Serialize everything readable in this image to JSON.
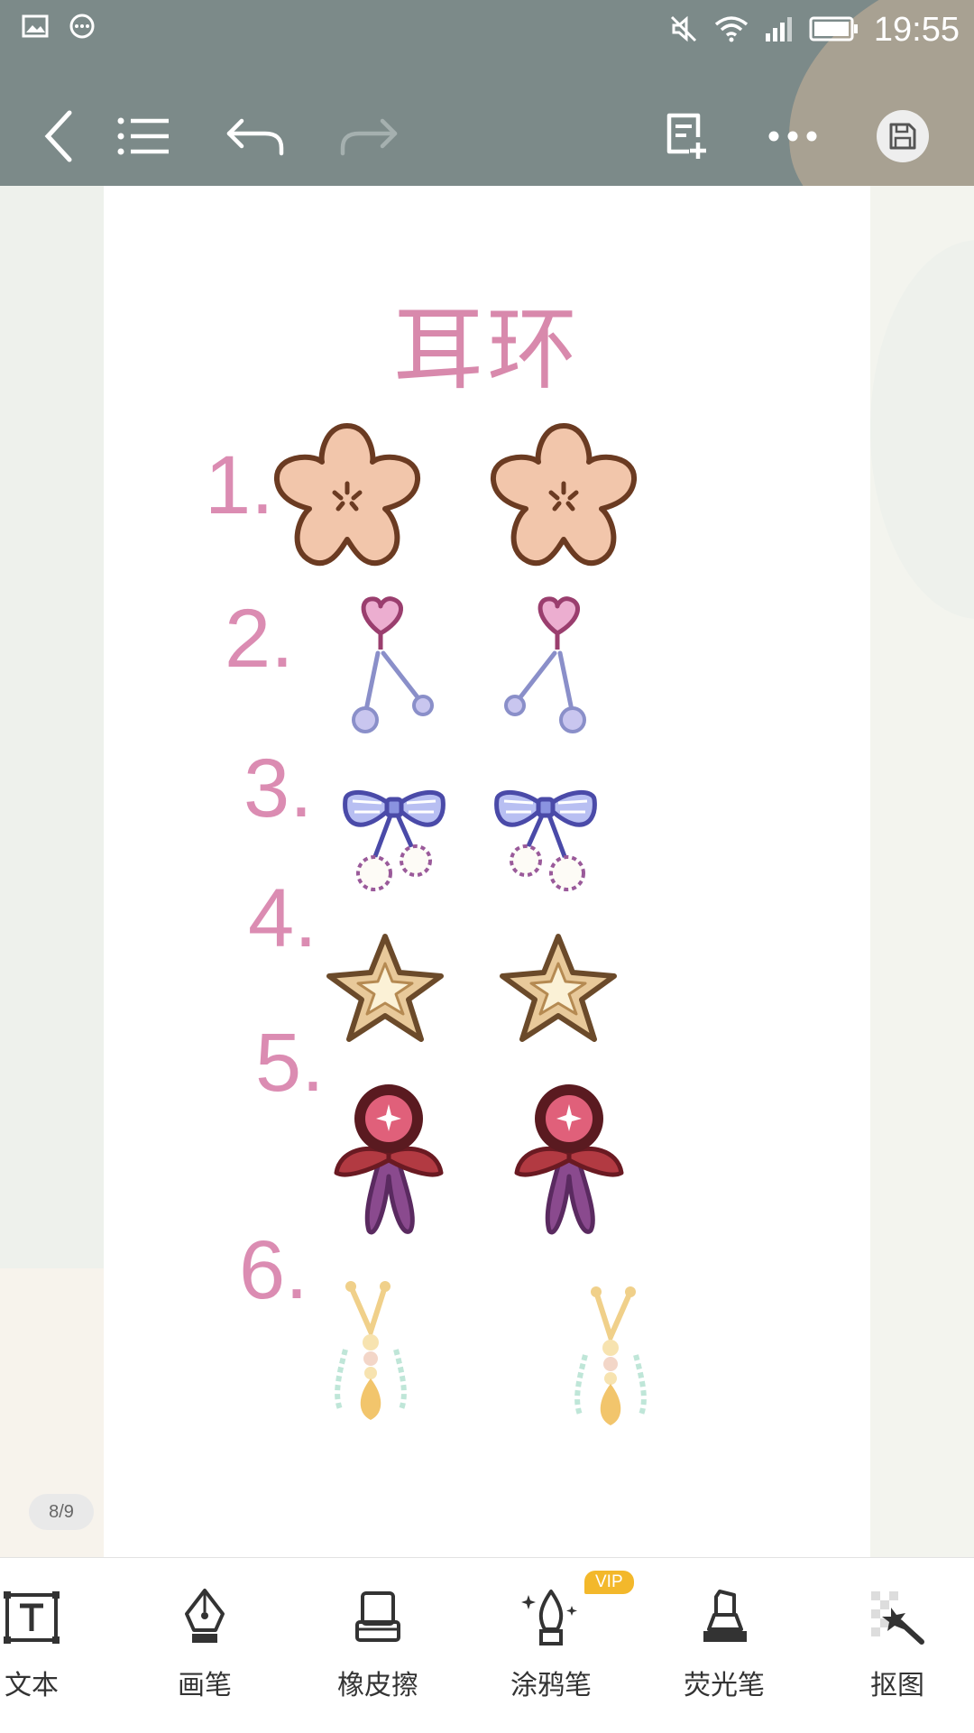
{
  "status_bar": {
    "time": "19:55",
    "left_icons": [
      "image-icon",
      "message-icon"
    ],
    "right_icons": [
      "mute-icon",
      "wifi-icon",
      "signal-icon",
      "battery-icon"
    ]
  },
  "toolbar": {
    "buttons": [
      "back-icon",
      "list-icon",
      "undo-icon",
      "redo-icon",
      "add-page-icon",
      "more-icon",
      "save-icon"
    ],
    "redo_enabled": false
  },
  "page": {
    "title": "耳环",
    "items": [
      {
        "number": "1.",
        "icon": "flower-earring"
      },
      {
        "number": "2.",
        "icon": "heart-dangle-earring"
      },
      {
        "number": "3.",
        "icon": "bow-pompom-earring"
      },
      {
        "number": "4.",
        "icon": "star-earring"
      },
      {
        "number": "5.",
        "icon": "red-gem-ribbon-earring"
      },
      {
        "number": "6.",
        "icon": "gold-tassel-earring"
      }
    ],
    "page_counter": "8/9"
  },
  "bottom_tools": {
    "text": "文本",
    "brush": "画笔",
    "eraser": "橡皮擦",
    "doodle": "涂鸦笔",
    "doodle_badge": "VIP",
    "highlighter": "荧光笔",
    "cutout": "抠图"
  },
  "colors": {
    "topbar": "#7c8a89",
    "title_pink": "#d889ac",
    "vip_badge": "#f3b82b"
  }
}
